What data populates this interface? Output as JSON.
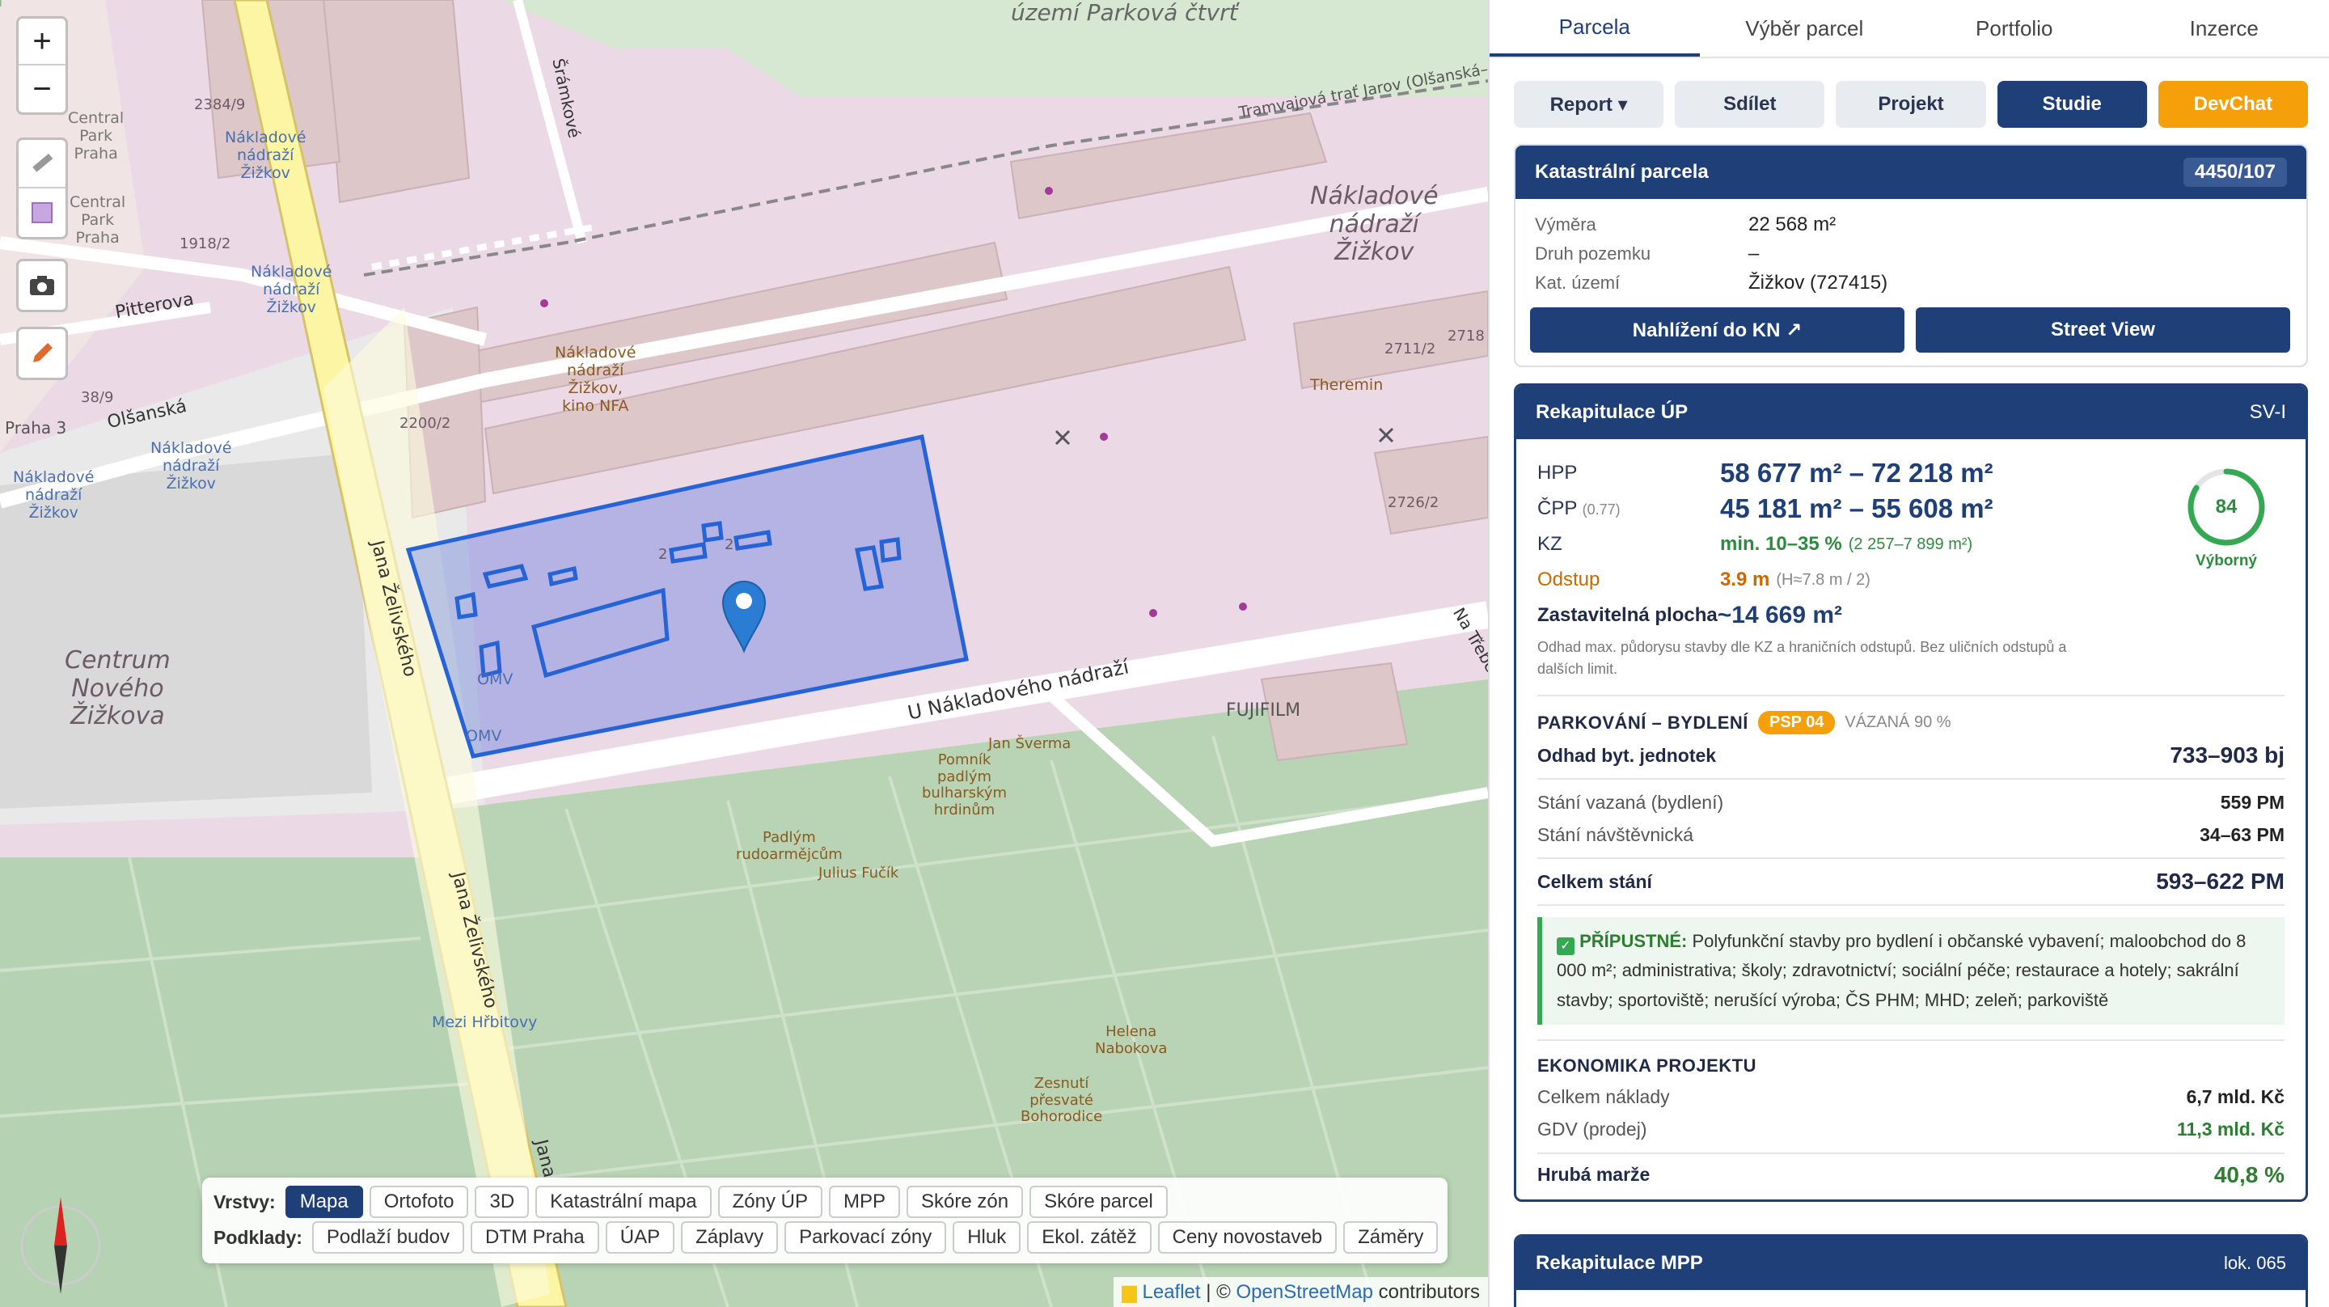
{
  "map": {
    "labels": {
      "park_quarter": "území Parková\nčtvrť",
      "nakladove_main": "Nákladové\nnádraží\nŽižkov",
      "kino": "Nákladové\nnádraží\nŽižkov,\nkino NFA",
      "theremin": "Theremin",
      "central_park_1": "Central\nPark\nPraha",
      "central_park_2": "Central\nPark\nPraha",
      "nakladove_l1": "Nákladové\nnádraží\nŽižkov",
      "nakladove_l2": "Nákladové\nnádraží\nŽižkov",
      "nakladove_l3": "Nákladové\nnádraží\nŽižkov",
      "nakladove_l4": "Nákladové\nnádraží\nŽižkov",
      "centrum": "Centrum\nNového\nŽižkova",
      "praha3": "Praha 3",
      "olsanska": "Olšanská",
      "pitterova": "Pitterova",
      "sramkove": "Šrámkové",
      "tramvajova": "Tramvajová trať Jarov (Olšanská–I",
      "u_nakladoveho": "U Nákladového nádraží",
      "zelivskeho_1": "Jana Želivského",
      "zelivskeho_2": "Jana Želivského",
      "jana": "Jana",
      "na_trebe": "Na Třebe",
      "fujifilm": "FUJIFILM",
      "omv_1": "OMV",
      "omv_2": "OMV",
      "jan_sverma": "Jan Šverma",
      "pomnik": "Pomník\npadlým\nbulharským\nhrdinům",
      "padlym": "Padlým\nrudoarmějcům",
      "fucik": "Julius Fučík",
      "helena": "Helena\nNabokova",
      "zesnuti": "Zesnutí\npřesvaté\nBohorodice",
      "mezi_hrbitovy": "Mezi Hřbitovy",
      "n2384": "2384/9",
      "n1918": "1918/2",
      "n38": "38/9",
      "n2200": "2200/2",
      "n2711": "2711/2",
      "n2718": "2718",
      "n2726": "2726/2",
      "n2a": "2",
      "n2b": "2"
    },
    "zoom_in": "+",
    "zoom_out": "−",
    "tools": [
      "ruler-icon",
      "polygon-icon",
      "camera-icon",
      "pencil-icon"
    ],
    "layers_label": "Vrstvy:",
    "layers": [
      "Mapa",
      "Ortofoto",
      "3D",
      "Katastrální mapa",
      "Zóny ÚP",
      "MPP",
      "Skóre zón",
      "Skóre parcel"
    ],
    "layers_active": "Mapa",
    "base_label": "Podklady:",
    "bases": [
      "Podlaží budov",
      "DTM Praha",
      "ÚAP",
      "Záplavy",
      "Parkovací zóny",
      "Hluk",
      "Ekol. zátěž",
      "Ceny novostaveb",
      "Záměry"
    ],
    "attribution": {
      "leaflet": "Leaflet",
      "sep": " | © ",
      "osm": "OpenStreetMap",
      "rest": " contributors"
    }
  },
  "panel": {
    "tabs": [
      "Parcela",
      "Výběr parcel",
      "Portfolio",
      "Inzerce"
    ],
    "active_tab": "Parcela",
    "actions": {
      "report": "Report ▾",
      "share": "Sdílet",
      "project": "Projekt",
      "study": "Studie",
      "devchat": "DevChat"
    },
    "cadastral": {
      "title": "Katastrální parcela",
      "number": "4450/107",
      "rows": [
        {
          "k": "Výměra",
          "v": "22 568 m²"
        },
        {
          "k": "Druh pozemku",
          "v": "–"
        },
        {
          "k": "Kat. území",
          "v": "Žižkov (727415)"
        }
      ],
      "btn_kn": "Nahlížení do KN ↗",
      "btn_sv": "Street View"
    },
    "up": {
      "title": "Rekapitulace ÚP",
      "code": "SV-I",
      "hpp_k": "HPP",
      "hpp_v": "58 677 m² – 72 218 m²",
      "cpp_k": "ČPP",
      "cpp_sub": "(0.77)",
      "cpp_v": "45 181 m² – 55 608 m²",
      "kz_k": "KZ",
      "kz_v": "min. 10–35 %",
      "kz_sub": "(2 257–7 899 m²)",
      "ods_k": "Odstup",
      "ods_v": "3.9 m",
      "ods_sub": "(H≈7.8 m / 2)",
      "zast_k": "Zastavitelná plocha",
      "zast_v": "~14 669 m²",
      "note": "Odhad max. půdorysu stavby dle KZ a hraničních odstupů. Bez uličních odstupů a dalších limit.",
      "score": 84,
      "score_label": "Výborný",
      "park_title": "PARKOVÁNÍ – BYDLENÍ",
      "psp": "PSP 04",
      "vazana": "VÁZANÁ 90 %",
      "units_k": "Odhad byt. jednotek",
      "units_v": "733–903 bj",
      "stani": [
        {
          "k": "Stání vazaná (bydlení)",
          "v": "559 PM"
        },
        {
          "k": "Stání návštěvnická",
          "v": "34–63 PM"
        }
      ],
      "total_k": "Celkem stání",
      "total_v": "593–622 PM",
      "perm_label": "PŘÍPUSTNÉ:",
      "perm_text": "Polyfunkční stavby pro bydlení i občanské vybavení; maloobchod do 8 000 m²; administrativa; školy; zdravotnictví; sociální péče; restaurace a hotely; sakrální stavby; sportoviště; nerušící výroba; ČS PHM; MHD; zeleň; parkoviště",
      "eco_title": "EKONOMIKA PROJEKTU",
      "eco_rows": [
        {
          "k": "Celkem náklady",
          "v": "6,7 mld. Kč"
        },
        {
          "k": "GDV (prodej)",
          "v": "11,3 mld. Kč"
        }
      ],
      "margin_k": "Hrubá marže",
      "margin_v": "40,8 %"
    },
    "mpp": {
      "title": "Rekapitulace MPP",
      "code": "lok. 065"
    },
    "colors": {
      "navy": "#1f3f79",
      "orange": "#f5a00a",
      "green": "#34a853",
      "brown": "#c96a00"
    }
  }
}
